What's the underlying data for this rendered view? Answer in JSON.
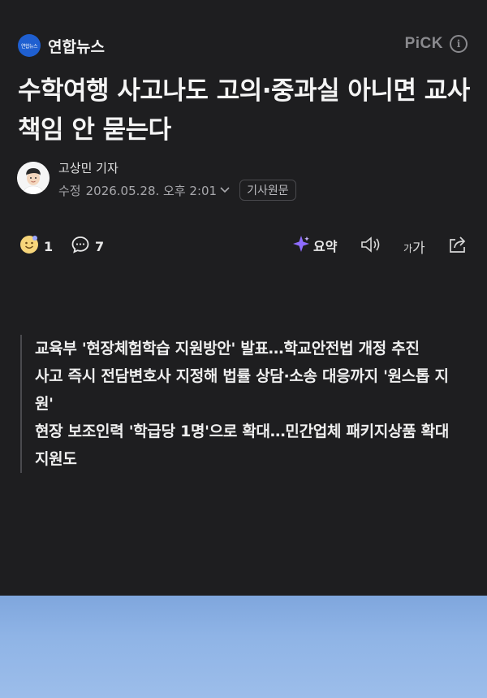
{
  "press": {
    "name": "연합뉴스",
    "logo_text": "연합뉴스"
  },
  "pick": {
    "label": "PiCK",
    "info_icon": "info-icon"
  },
  "article": {
    "headline": "수학여행 사고나도 고의·중과실 아니면 교사 책임 안 묻는다",
    "reporter": "고상민 기자",
    "date_label": "수정",
    "date": "2026.05.28. 오후 2:01",
    "original_button": "기사원문"
  },
  "actions": {
    "reaction_icon": "smile-face-icon",
    "reaction_count": "1",
    "comment_icon": "speech-bubble-icon",
    "comment_count": "7",
    "summary_icon": "sparkle-icon",
    "summary_label": "요약",
    "audio_icon": "speaker-icon",
    "font_label_small": "가",
    "font_label_large": "가",
    "share_icon": "share-icon"
  },
  "summary": {
    "lines": [
      "교육부 '현장체험학습 지원방안' 발표…학교안전법 개정 추진",
      "사고 즉시 전담변호사 지정해 법률 상담·소송 대응까지 '원스톱 지원'",
      "현장 보조인력 '학급당 1명'으로 확대…민간업체 패키지상품 확대 지원도"
    ]
  },
  "colors": {
    "background": "#1e1e20",
    "accent_blue": "#1f5fd0",
    "photo_sky": "#8fb4e6"
  }
}
